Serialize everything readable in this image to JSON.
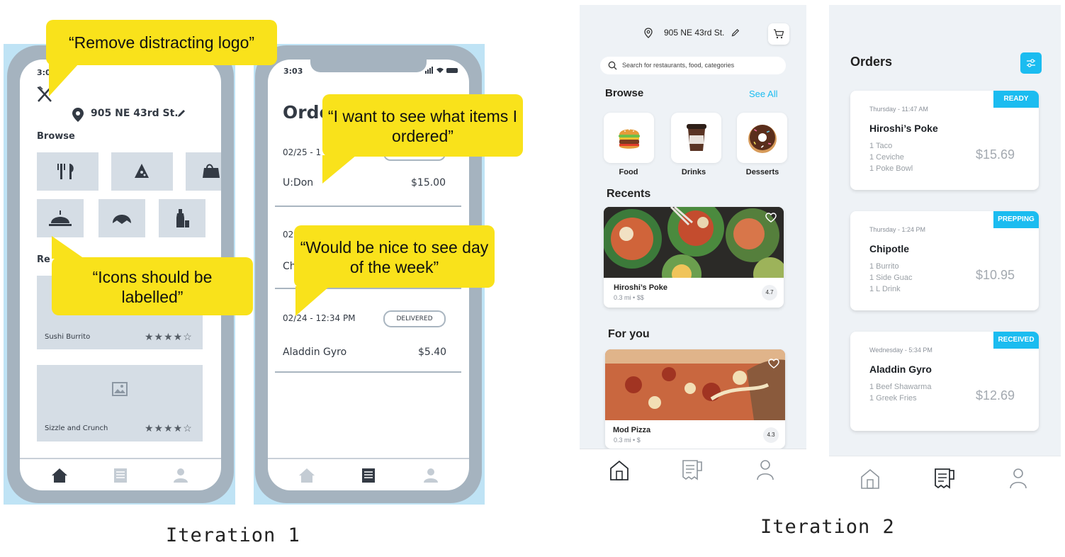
{
  "captions": {
    "iteration1": "Iteration 1",
    "iteration2": "Iteration 2"
  },
  "wireframe1": {
    "status_time": "3:03",
    "address": "905 NE 43rd St.",
    "browse_label": "Browse",
    "recents_label": "Re",
    "recent_items": [
      {
        "name": "Sushi Burrito",
        "stars": "★★★★☆"
      },
      {
        "name": "Sizzle and Crunch",
        "stars": "★★★★☆"
      }
    ]
  },
  "wireframe2": {
    "status_time": "3:03",
    "title": "Orde",
    "orders": [
      {
        "date": "02/25 - 1",
        "name": "U:Don",
        "price": "$15.00"
      },
      {
        "date": "02",
        "name": "Ch"
      },
      {
        "date": "02/24 - 12:34 PM",
        "name": "Aladdin Gyro",
        "price": "$5.40",
        "status": "DELIVERED"
      }
    ]
  },
  "feedback": {
    "logo": "“Remove distracting logo”",
    "items": "“I want to see what items I ordered”",
    "day": "“Would be nice to see day of the week”",
    "icons": "“Icons should be labelled”"
  },
  "home": {
    "address": "905 NE 43rd St.",
    "search_placeholder": "Search for restaurants, food, categories",
    "browse_title": "Browse",
    "see_all": "See All",
    "categories": [
      {
        "label": "Food",
        "icon": "burger-icon"
      },
      {
        "label": "Drinks",
        "icon": "coffee-cup-icon"
      },
      {
        "label": "Desserts",
        "icon": "donut-icon"
      }
    ],
    "recents_title": "Recents",
    "recent": {
      "name": "Hiroshi’s Poke",
      "distance": "0.3 mi",
      "dot": "•",
      "price_level": "$$",
      "rating": "4.7"
    },
    "for_you_title": "For you",
    "for_you": {
      "name": "Mod Pizza",
      "distance": "0.3 mi",
      "dot": "•",
      "price_level": "$",
      "rating": "4.3"
    }
  },
  "orders_screen": {
    "title": "Orders",
    "orders": [
      {
        "status": "READY",
        "date": "Thursday - 11:47 AM",
        "name": "Hiroshi’s Poke",
        "items": [
          "1 Taco",
          "1 Ceviche",
          "1 Poke Bowl"
        ],
        "price": "$15.69"
      },
      {
        "status": "PREPPING",
        "date": "Thursday - 1:24 PM",
        "name": "Chipotle",
        "items": [
          "1 Burrito",
          "1 Side Guac",
          "1 L Drink"
        ],
        "price": "$10.95"
      },
      {
        "status": "RECEIVED",
        "date": "Wednesday - 5:34 PM",
        "name": "Aladdin Gyro",
        "items": [
          "1 Beef Shawarma",
          "1 Greek Fries"
        ],
        "price": "$12.69"
      }
    ]
  },
  "colors": {
    "accent": "#1bbcf0",
    "bubble": "#f9e21b",
    "wireframe_frame": "#a5b3bf",
    "wireframe_bg": "#bfe3f5"
  }
}
